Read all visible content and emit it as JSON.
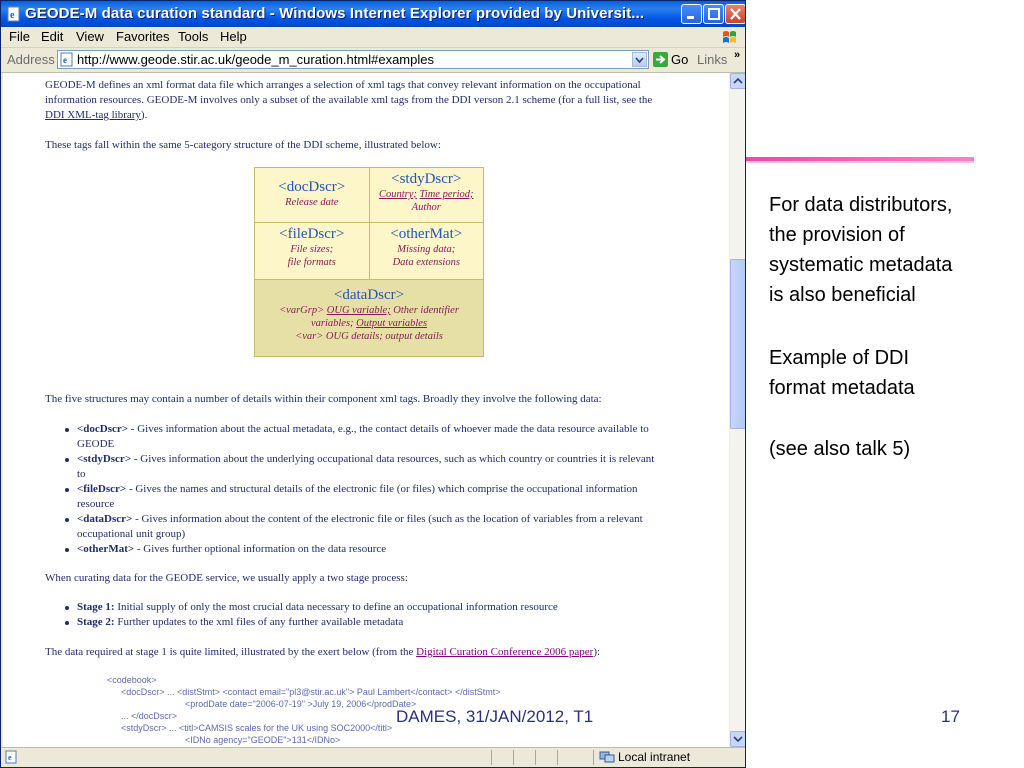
{
  "window": {
    "title": "GEODE-M data curation standard - Windows Internet Explorer provided by Universit...",
    "menu": [
      "File",
      "Edit",
      "View",
      "Favorites",
      "Tools",
      "Help"
    ],
    "address_label": "Address",
    "url": "http://www.geode.stir.ac.uk/geode_m_curation.html#examples",
    "go_label": "Go",
    "links_label": "Links",
    "links_chevron": "»",
    "status_zone": "Local intranet"
  },
  "page": {
    "intro_line1": "GEODE-M defines an xml format data file which arranges a selection of xml tags that convey relevant information on the occupational",
    "intro_line2": "information resources. GEODE-M involves only a subset of the available xml tags from the DDI verson 2.1 scheme (for a full list, see the",
    "intro_link": "DDI XML-tag library",
    "intro_end": ").",
    "tags_sentence": "These tags fall within the same 5-category structure of the DDI scheme, illustrated below:",
    "ddi": {
      "docDscr": {
        "name": "<docDscr>",
        "desc": "Release date"
      },
      "stdyDscr": {
        "name": "<stdyDscr>",
        "desc_link1": "Country;",
        "desc_link2": "Time period;",
        "desc_line2": "Author"
      },
      "fileDscr": {
        "name": "<fileDscr>",
        "desc_line1": "File sizes;",
        "desc_line2": "file formats"
      },
      "otherMat": {
        "name": "<otherMat>",
        "desc_line1": "Missing data;",
        "desc_line2": "Data extensions"
      },
      "dataDscr": {
        "name": "<dataDscr>",
        "l1_a": "<varGrp>",
        "l1_link": "OUG variable;",
        "l1_b": "Other identifier",
        "l2_a": "variables;",
        "l2_link": "Output variables",
        "l3": "<var> OUG details; output details"
      }
    },
    "structures_sentence": "The five structures may contain a number of details within their component xml tags. Broadly they involve the following data:",
    "bullets": [
      {
        "tag": "<docDscr>",
        "text1": " - Gives information about the actual metadata, e.g., the contact details of whoever made the data resource available to",
        "text2": "GEODE"
      },
      {
        "tag": "<stdyDscr>",
        "text1": " - Gives information about the underlying occupational data resources, such as which country or countries it is relevant",
        "text2": "to"
      },
      {
        "tag": "<fileDscr>",
        "text1": " - Gives the names and structural details of the electronic file (or files) which comprise the occupational information",
        "text2": "resource"
      },
      {
        "tag": "<dataDscr>",
        "text1": " - Gives information about the content of the electronic file or files (such as the location of variables from a relevant",
        "text2": "occupational unit group)"
      },
      {
        "tag": "<otherMat>",
        "text1": " - Gives further optional information on the data resource",
        "text2": ""
      }
    ],
    "curating_sentence": "When curating data for the GEODE service, we usually apply a two stage process:",
    "stages": [
      {
        "label": "Stage 1:",
        "text": " Initial supply of only the most crucial data necessary to define an occupational information resource"
      },
      {
        "label": "Stage 2:",
        "text": " Further updates to the xml files of any further available metadata"
      }
    ],
    "stage1_sentence": "The data required at stage 1 is quite limited, illustrated by the exert below (from the ",
    "stage1_link": "Digital Curation Conference 2006 paper",
    "stage1_end": "):",
    "code_lines": [
      "<codebook>",
      "<docDscr> ... <distStmt> <contact email=\"pl3@stir.ac.uk\"> Paul Lambert</contact> </distStmt>",
      "<prodDate date=\"2006-07-19\" >July 19, 2006</prodDate>",
      "... </docDscr>",
      "<stdyDscr> ... <titl>CAMSIS scales for the UK using SOC2000</titl>",
      "<IDNo agency=\"GEODE\">131</IDNo>"
    ]
  },
  "slide": {
    "side_lines_1": [
      "For data distributors,",
      "the provision of",
      "systematic metadata",
      "is also beneficial"
    ],
    "side_lines_2": [
      "Example of DDI",
      "format metadata"
    ],
    "side_line_3": "(see also talk 5)",
    "footer": "DAMES, 31/JAN/2012, T1",
    "page_number": "17"
  },
  "colors": {
    "accent": "#ff5ab4",
    "footer": "#2a3080",
    "page_text": "#1f2d6b",
    "table_bg": "#fdf6c8"
  }
}
